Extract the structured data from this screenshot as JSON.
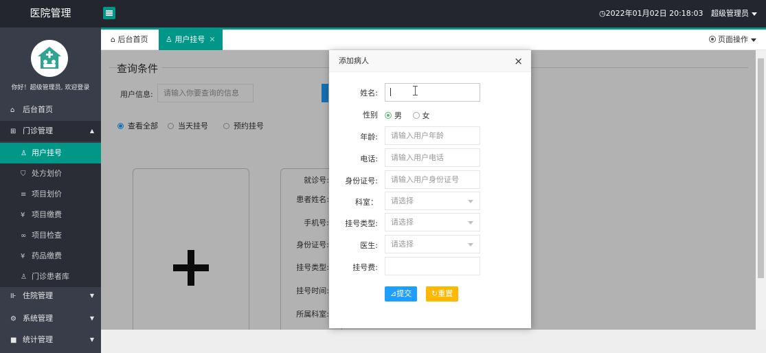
{
  "header": {
    "brand": "医院管理",
    "datetime": "◷2022年01月02日 20:18:03",
    "user": "超级管理员"
  },
  "sidebar": {
    "greeting": "你好！超级管理员, 欢迎登录",
    "items": [
      {
        "icon": "⌂",
        "label": "后台首页"
      },
      {
        "icon": "⊞",
        "label": "门诊管理",
        "arrow": "▲"
      },
      {
        "icon": "⊪",
        "label": "住院管理",
        "arrow": "▼"
      },
      {
        "icon": "⚙",
        "label": "系统管理",
        "arrow": "▼"
      },
      {
        "icon": "■",
        "label": "统计管理",
        "arrow": "▼"
      }
    ],
    "subitems": [
      {
        "icon": "♙",
        "label": "用户挂号"
      },
      {
        "icon": "⛉",
        "label": "处方划价"
      },
      {
        "icon": "≡",
        "label": "项目划价"
      },
      {
        "icon": "¥",
        "label": "项目缴费"
      },
      {
        "icon": "∞",
        "label": "项目检查"
      },
      {
        "icon": "¥",
        "label": "药品缴费"
      },
      {
        "icon": "♙",
        "label": "门诊患者库"
      }
    ]
  },
  "tabs": [
    {
      "icon": "⌂",
      "label": "后台首页"
    },
    {
      "icon": "♙",
      "label": "用户挂号",
      "close": "✕"
    }
  ],
  "page_op": "页面操作",
  "query": {
    "title": "查询条件",
    "user_info_label": "用户信息:",
    "user_info_placeholder": "请输入你要查询的信息",
    "filters": [
      "查看全部",
      "当天挂号",
      "预约挂号"
    ]
  },
  "info_card_labels": [
    "就诊号:",
    "患者姓名:",
    "手机号:",
    "身份证号:",
    "挂号类型:",
    "挂号时间:",
    "所属科室:"
  ],
  "modal": {
    "title": "添加病人",
    "close": "×",
    "fields": {
      "name_label": "姓名:",
      "name_value": "",
      "gender_label": "性别",
      "gender_male": "男",
      "gender_female": "女",
      "age_label": "年龄:",
      "age_placeholder": "请输入用户年龄",
      "phone_label": "电话:",
      "phone_placeholder": "请输入用户电话",
      "id_label": "身份证号:",
      "id_placeholder": "请输入用户身份证号",
      "dept_label": "科室：",
      "dept_value": "请选择",
      "regtype_label": "挂号类型:",
      "regtype_value": "请选择",
      "doctor_label": "医生:",
      "doctor_value": "请选择",
      "fee_label": "挂号费:",
      "fee_value": ""
    },
    "submit": "⊿提交",
    "reset": "↻重置"
  }
}
